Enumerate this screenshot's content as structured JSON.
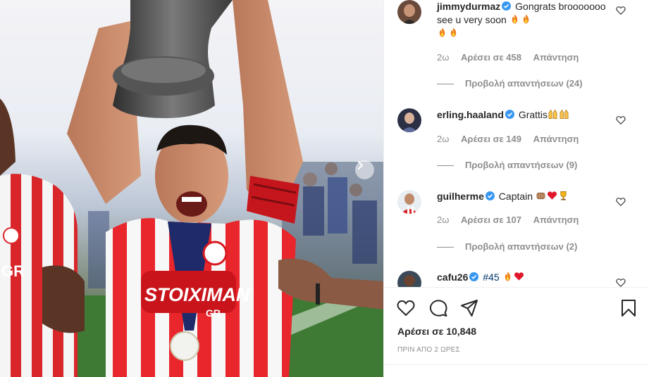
{
  "comments": [
    {
      "username": "jimmydurmaz",
      "verified": true,
      "text": "Gongrats brooooooo see u very soon",
      "emojis": [
        "fire-emoji",
        "fire-emoji",
        "fire-emoji",
        "fire-emoji"
      ],
      "time": "2ω",
      "likes": "Αρέσει σε 458",
      "reply": "Απάντηση",
      "view_replies": "Προβολή απαντήσεων (24)"
    },
    {
      "username": "erling.haaland",
      "verified": true,
      "text": "Grattis",
      "emojis": [
        "raising-hands-emoji",
        "raising-hands-emoji"
      ],
      "time": "2ω",
      "likes": "Αρέσει σε 149",
      "reply": "Απάντηση",
      "view_replies": "Προβολή απαντήσεων (9)"
    },
    {
      "username": "guilherme",
      "verified": true,
      "text": "Captain",
      "emojis": [
        "fist-bump-emoji",
        "red-heart-emoji",
        "trophy-emoji"
      ],
      "time": "2ω",
      "likes": "Αρέσει σε 107",
      "reply": "Απάντηση",
      "view_replies": "Προβολή απαντήσεων (2)"
    },
    {
      "username": "cafu26",
      "verified": true,
      "tag": "#45",
      "emojis": [
        "fire-emoji",
        "red-heart-emoji"
      ]
    }
  ],
  "post": {
    "likes": "Αρέσει σε 10,848",
    "time_ago": "ΠΡΙΝ ΑΠΟ 2 ΩΡΕΣ"
  },
  "photo": {
    "sponsor_text": "STOIXIMAN",
    "sponsor_suffix": "GR",
    "left_player_text": "GR"
  },
  "icons": {
    "like": "heart-icon",
    "comment": "comment-icon",
    "share": "paper-plane-icon",
    "save": "bookmark-icon",
    "carousel": "chevron-right-icon"
  },
  "colors": {
    "verified": "#3897f0",
    "link": "#00376b",
    "muted": "#8e8e8e",
    "kit_red": "#d71920"
  }
}
